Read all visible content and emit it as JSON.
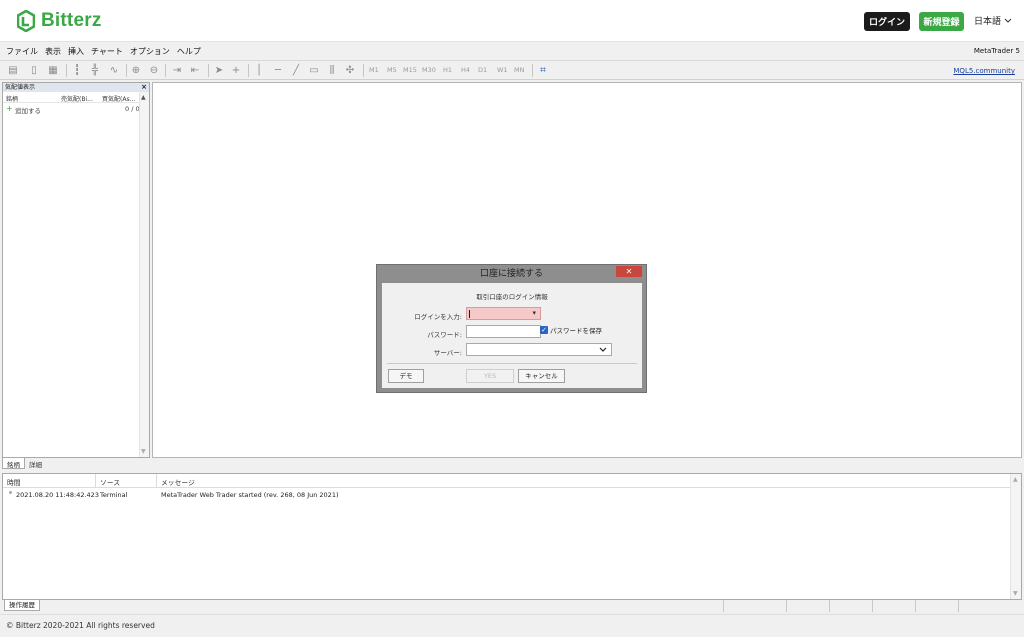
{
  "site": {
    "brand": "Bitterz",
    "brand_color": "#3aa845",
    "login_button": "ログイン",
    "register_button": "新規登録",
    "language": "日本語"
  },
  "menu": {
    "items": [
      "ファイル",
      "表示",
      "挿入",
      "チャート",
      "オプション",
      "ヘルプ"
    ],
    "app_name": "MetaTrader 5"
  },
  "toolbar": {
    "timeframes": [
      "M1",
      "M5",
      "M15",
      "M30",
      "H1",
      "H4",
      "D1",
      "W1",
      "MN"
    ],
    "community_link": "MQL5.community"
  },
  "market_watch": {
    "title": "気配値表示",
    "columns": [
      "銘柄",
      "売気配(Bi...",
      "買気配(As..."
    ],
    "add_label": "追加する",
    "count": "0 / 0",
    "tabs": [
      "銘柄",
      "詳細"
    ]
  },
  "dialog": {
    "title": "口座に接続する",
    "subtitle": "取引口座のログイン情報",
    "login_label": "ログインを入力:",
    "password_label": "パスワード:",
    "save_password_label": "パスワードを保存",
    "server_label": "サーバー:",
    "demo_button": "デモ",
    "yes_button": "YES",
    "cancel_button": "キャンセル",
    "close_button": "✕",
    "error_color": "#f6c9c9"
  },
  "toolbox": {
    "columns": [
      "時間",
      "ソース",
      "メッセージ"
    ],
    "rows": [
      {
        "time": "2021.08.20 11:48:42.423",
        "source": "Terminal",
        "message": "MetaTrader Web Trader started (rev. 268, 08 Jun 2021)"
      }
    ],
    "tab": "操作履歴"
  },
  "footer": {
    "copyright": "© Bitterz 2020-2021 All rights reserved"
  }
}
